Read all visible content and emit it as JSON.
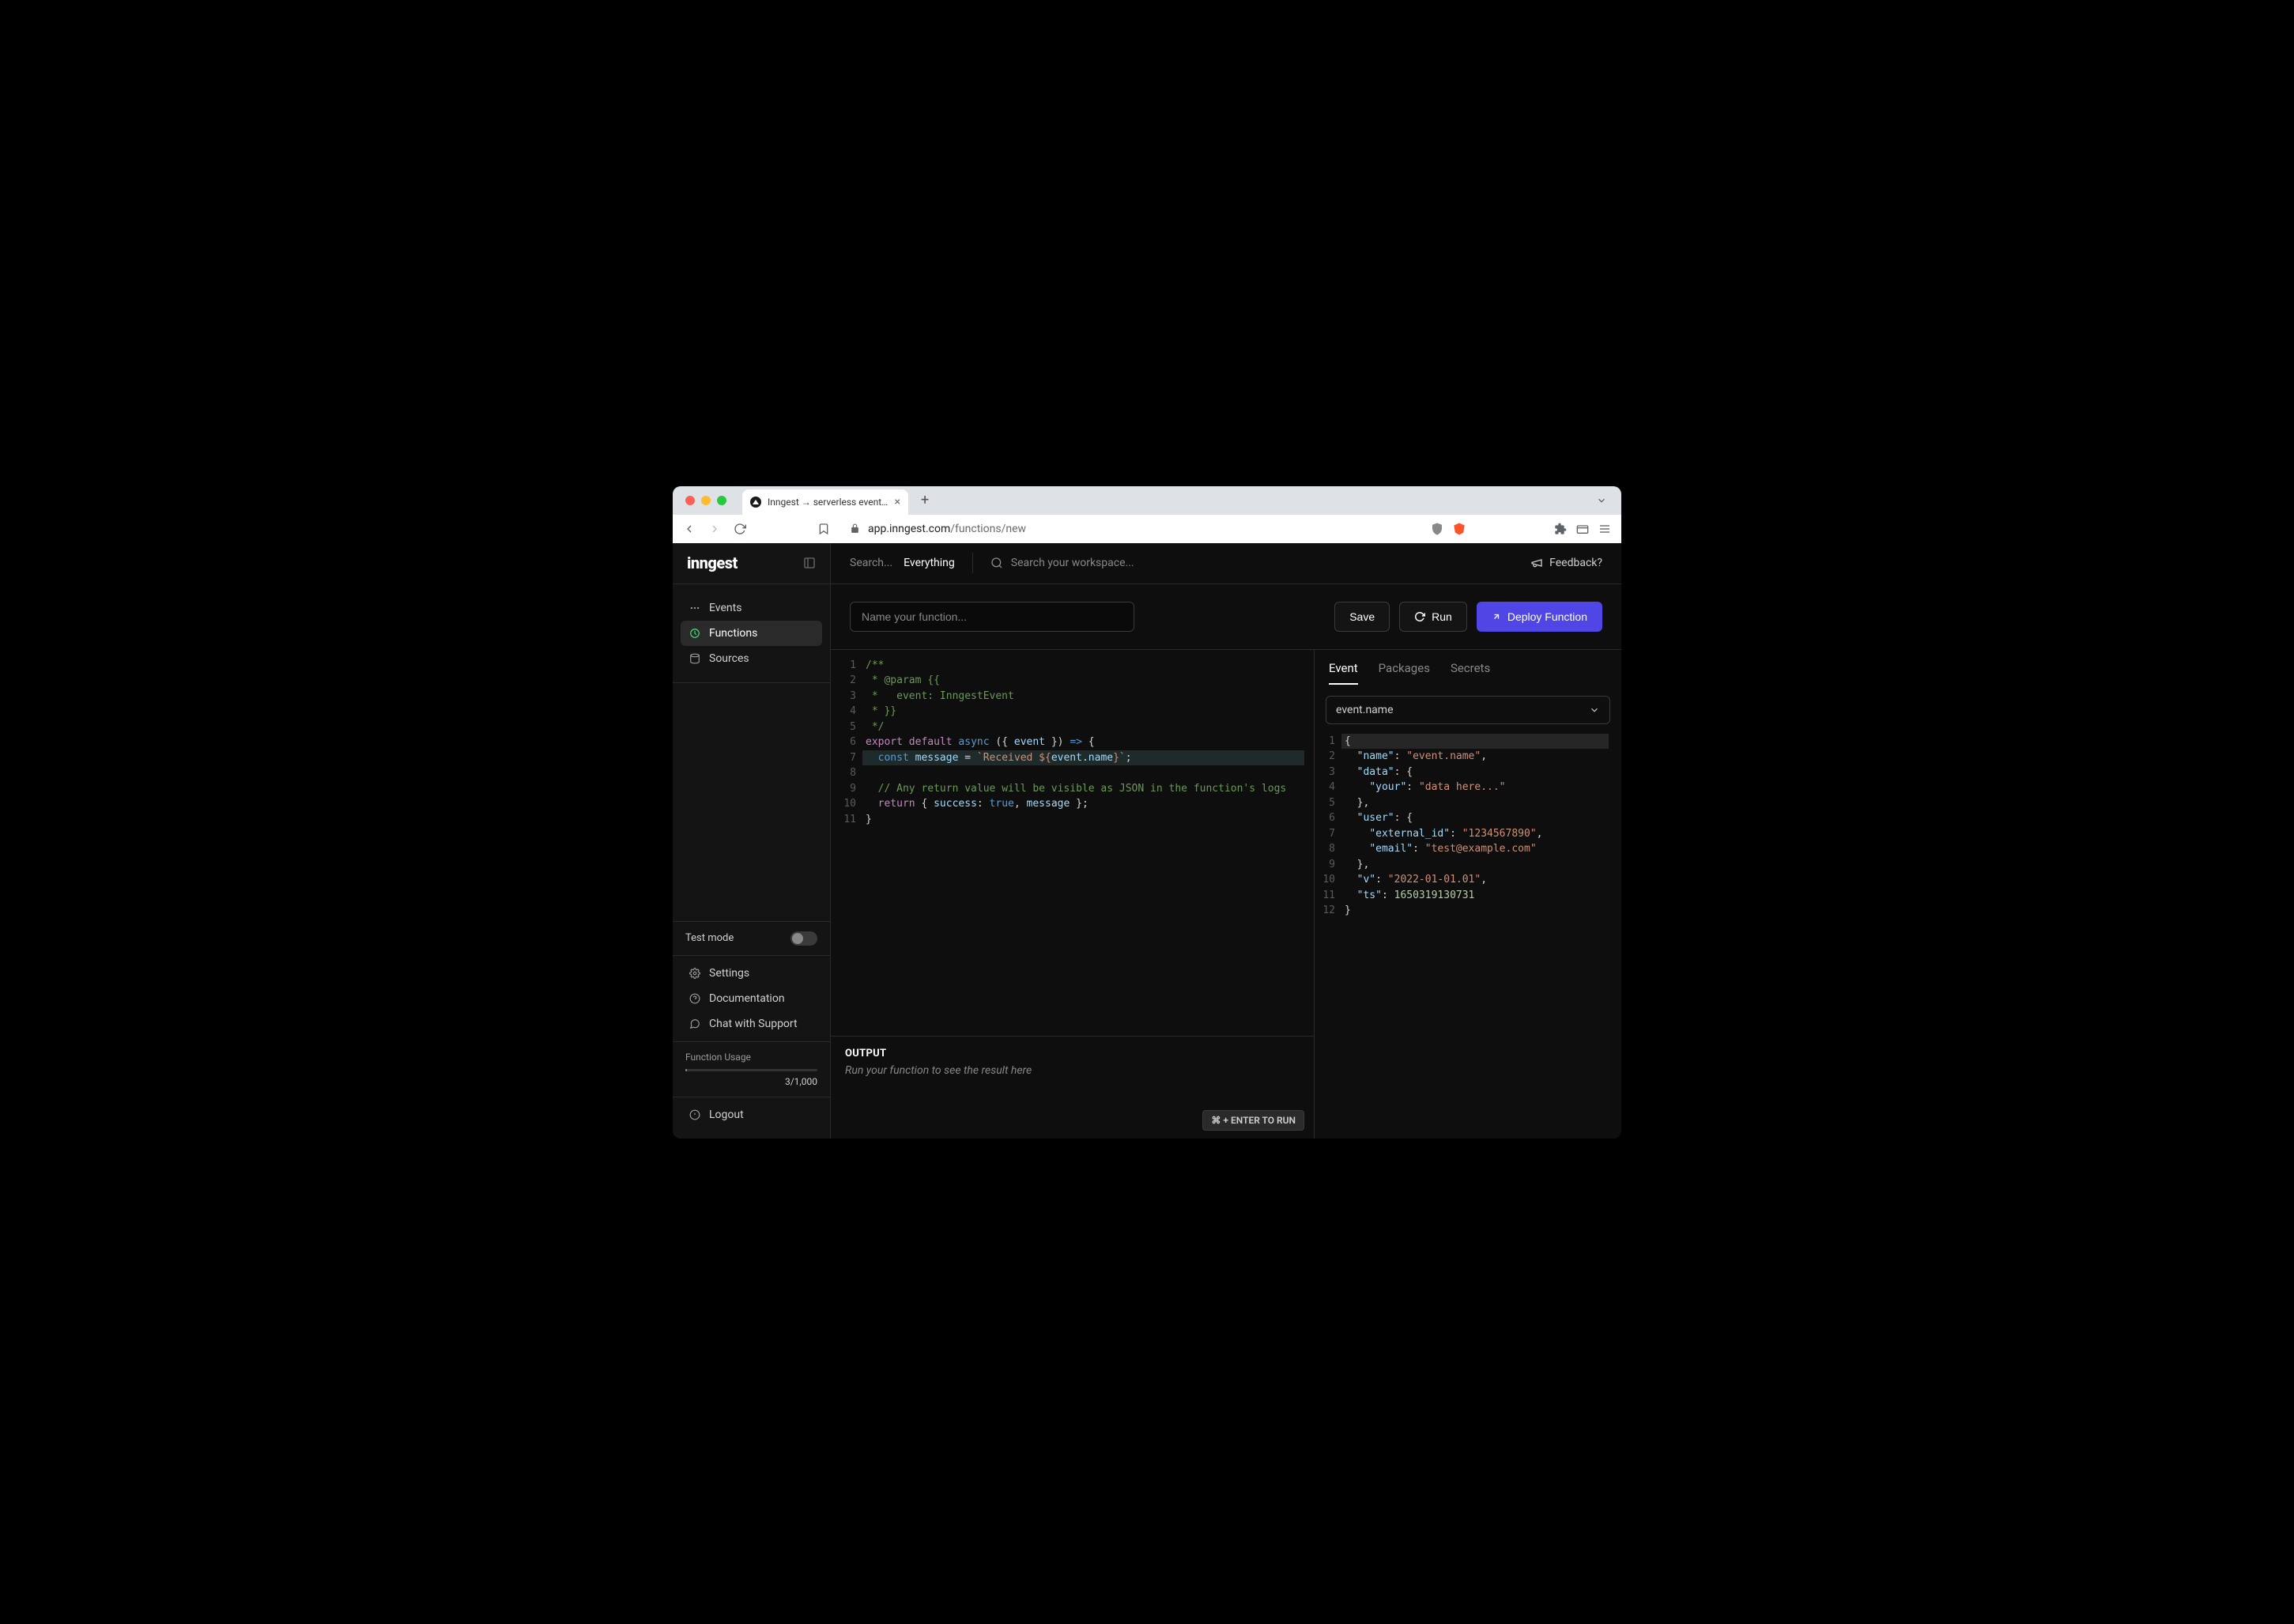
{
  "browser": {
    "tab_title": "Inngest → serverless event-driv",
    "url_host": "app.inngest.com",
    "url_path": "/functions/new"
  },
  "sidebar": {
    "logo": "inngest",
    "nav": [
      {
        "label": "Events"
      },
      {
        "label": "Functions"
      },
      {
        "label": "Sources"
      }
    ],
    "test_mode_label": "Test mode",
    "footer": [
      {
        "label": "Settings"
      },
      {
        "label": "Documentation"
      },
      {
        "label": "Chat with Support"
      }
    ],
    "usage_label": "Function Usage",
    "usage_value": "3/1,000",
    "logout": "Logout"
  },
  "topbar": {
    "search_label": "Search...",
    "scope": "Everything",
    "workspace_placeholder": "Search your workspace...",
    "feedback": "Feedback?"
  },
  "actions": {
    "name_placeholder": "Name your function...",
    "save": "Save",
    "run": "Run",
    "deploy": "Deploy Function"
  },
  "editor": {
    "run_hint": "⌘ + ENTER TO RUN",
    "lines": [
      {
        "n": "1",
        "html": "<span class='tok-comment'>/**</span>"
      },
      {
        "n": "2",
        "html": "<span class='tok-comment'> * @param {{</span>"
      },
      {
        "n": "3",
        "html": "<span class='tok-comment'> *   event: InngestEvent</span>"
      },
      {
        "n": "4",
        "html": "<span class='tok-comment'> * }}</span>"
      },
      {
        "n": "5",
        "html": "<span class='tok-comment'> */</span>"
      },
      {
        "n": "6",
        "html": "<span class='tok-keyword'>export</span> <span class='tok-keyword'>default</span> <span class='tok-keyword2'>async</span> <span class='tok-punct'>({ </span><span class='tok-var'>event</span><span class='tok-punct'> }) </span><span class='tok-keyword2'>=&gt;</span><span class='tok-punct'> {</span>"
      },
      {
        "n": "7",
        "hl": true,
        "html": "  <span class='tok-keyword2'>const</span> <span class='tok-var'>message</span> <span class='tok-punct'>=</span> <span class='tok-string'>`Received ${</span><span class='tok-var'>event</span><span class='tok-punct'>.</span><span class='tok-prop'>name</span><span class='tok-string'>}`</span><span class='tok-punct'>;</span>"
      },
      {
        "n": "8",
        "html": ""
      },
      {
        "n": "9",
        "html": "  <span class='tok-comment'>// Any return value will be visible as JSON in the function's logs</span>"
      },
      {
        "n": "10",
        "html": "  <span class='tok-keyword'>return</span> <span class='tok-punct'>{ </span><span class='tok-prop'>success</span><span class='tok-punct'>: </span><span class='tok-literal'>true</span><span class='tok-punct'>, </span><span class='tok-var'>message</span><span class='tok-punct'> };</span>"
      },
      {
        "n": "11",
        "html": "<span class='tok-punct'>}</span>"
      }
    ]
  },
  "side": {
    "tabs": [
      "Event",
      "Packages",
      "Secrets"
    ],
    "event_select": "event.name",
    "json_lines": [
      {
        "n": "1",
        "hl": true,
        "html": "<span class='tok-punct'>{</span>"
      },
      {
        "n": "2",
        "html": "  <span class='tok-prop'>\"name\"</span><span class='tok-punct'>: </span><span class='tok-string'>\"event.name\"</span><span class='tok-punct'>,</span>"
      },
      {
        "n": "3",
        "html": "  <span class='tok-prop'>\"data\"</span><span class='tok-punct'>: {</span>"
      },
      {
        "n": "4",
        "html": "    <span class='tok-prop'>\"your\"</span><span class='tok-punct'>: </span><span class='tok-string'>\"data here...\"</span>"
      },
      {
        "n": "5",
        "html": "  <span class='tok-punct'>},</span>"
      },
      {
        "n": "6",
        "html": "  <span class='tok-prop'>\"user\"</span><span class='tok-punct'>: {</span>"
      },
      {
        "n": "7",
        "html": "    <span class='tok-prop'>\"external_id\"</span><span class='tok-punct'>: </span><span class='tok-string'>\"1234567890\"</span><span class='tok-punct'>,</span>"
      },
      {
        "n": "8",
        "html": "    <span class='tok-prop'>\"email\"</span><span class='tok-punct'>: </span><span class='tok-string'>\"test@example.com\"</span>"
      },
      {
        "n": "9",
        "html": "  <span class='tok-punct'>},</span>"
      },
      {
        "n": "10",
        "html": "  <span class='tok-prop'>\"v\"</span><span class='tok-punct'>: </span><span class='tok-string'>\"2022-01-01.01\"</span><span class='tok-punct'>,</span>"
      },
      {
        "n": "11",
        "html": "  <span class='tok-prop'>\"ts\"</span><span class='tok-punct'>: </span><span class='tok-number'>1650319130731</span>"
      },
      {
        "n": "12",
        "html": "<span class='tok-punct'>}</span>"
      }
    ]
  },
  "output": {
    "title": "OUTPUT",
    "placeholder": "Run your function to see the result here"
  }
}
